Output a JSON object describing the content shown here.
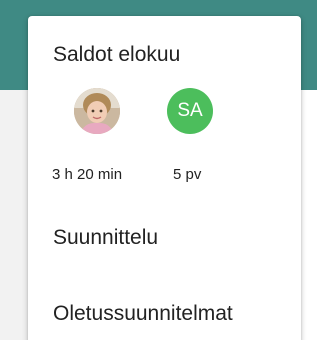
{
  "menu": {
    "balances_title": "Saldot elokuu",
    "avatars": [
      {
        "type": "photo",
        "icon": "child-photo"
      },
      {
        "type": "initials",
        "initials": "SA",
        "color": "#4cbe5c"
      }
    ],
    "balances": [
      "3 h 20 min",
      "5 pv"
    ],
    "items": [
      {
        "label": "Suunnittelu"
      },
      {
        "label": "Oletussuunnitelmat"
      }
    ]
  },
  "colors": {
    "header": "#3f8a84",
    "background": "#f2f2f2",
    "menu_background": "#ffffff",
    "text": "#222222"
  }
}
